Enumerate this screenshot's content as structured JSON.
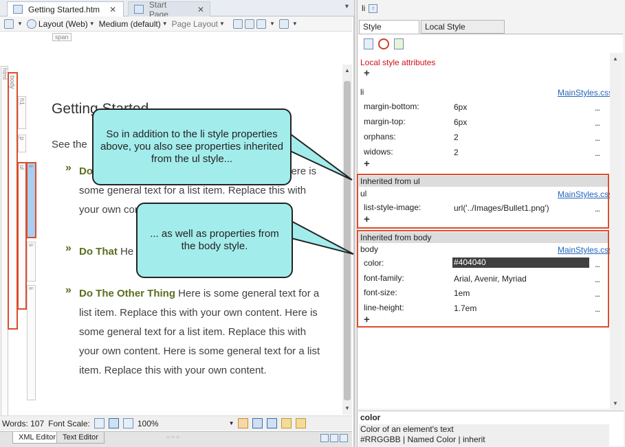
{
  "editor": {
    "tabs": [
      {
        "label": "Getting Started.htm",
        "close": "✕"
      },
      {
        "label": "Start Page",
        "close": "✕"
      }
    ],
    "toolbar": {
      "layout": "Layout (Web)",
      "medium": "Medium (default)",
      "page_layout": "Page Layout"
    },
    "span_tag": "span",
    "structure_labels": {
      "html": "html",
      "body": "body",
      "h1": "h1",
      "p": "p",
      "ul": "ul",
      "li": "li"
    },
    "content": {
      "title": "Getting Started",
      "intro": "See the",
      "items": [
        {
          "bold": "Do",
          "rest": " tem. Replace this with your own content. Here is some general text for a list item. Replace this with your own content"
        },
        {
          "bold": "Do That",
          "rest": " He tem. Replace this"
        },
        {
          "bold": "Do The Other Thing",
          "rest": " Here is some general text for a list item. Replace this with your own content. Here is some general text for a list item. Replace this with your own content. Here is some general text for a list item. Replace this with your own content."
        }
      ],
      "bullet": "»"
    },
    "status": {
      "words": "Words: 107",
      "font_scale": "Font Scale:",
      "zoom": "100%"
    },
    "bottom_tabs": [
      "XML Editor",
      "Text Editor"
    ],
    "dots": "○ ○ ○"
  },
  "inspector": {
    "element": "li",
    "tabs": [
      "Style Inspector",
      "Local Style Properties"
    ],
    "local_attrs_label": "Local style attributes",
    "add": "+",
    "more": "...",
    "groups": [
      {
        "selector": "li",
        "source": "MainStyles.css",
        "props": [
          {
            "name": "margin-bottom:",
            "value": "6px"
          },
          {
            "name": "margin-top:",
            "value": "6px"
          },
          {
            "name": "orphans:",
            "value": "2"
          },
          {
            "name": "widows:",
            "value": "2"
          }
        ]
      },
      {
        "header": "Inherited from ul",
        "selector": "ul",
        "source": "MainStyles.css",
        "props": [
          {
            "name": "list-style-image:",
            "value": "url('../Images/Bullet1.png')"
          }
        ]
      },
      {
        "header": "Inherited from body",
        "selector": "body",
        "source": "MainStyles.css",
        "props": [
          {
            "name": "color:",
            "value": "#404040"
          },
          {
            "name": "font-family:",
            "value": "Arial, Avenir, Myriad"
          },
          {
            "name": "font-size:",
            "value": "1em"
          },
          {
            "name": "line-height:",
            "value": "1.7em"
          }
        ]
      }
    ],
    "description": {
      "title": "color",
      "line1": "Color of an element's text",
      "line2": "#RRGGBB | Named Color | inherit"
    }
  },
  "callouts": {
    "first": "So in addition to the li style properties above, you also see properties inherited from the ul style...",
    "second": "... as well as properties from the body style."
  },
  "colors": {
    "accent_red": "#dc4c2c",
    "callout_fill": "#a3ecec",
    "item_bold": "#5a6e1f",
    "link": "#2266bb"
  }
}
